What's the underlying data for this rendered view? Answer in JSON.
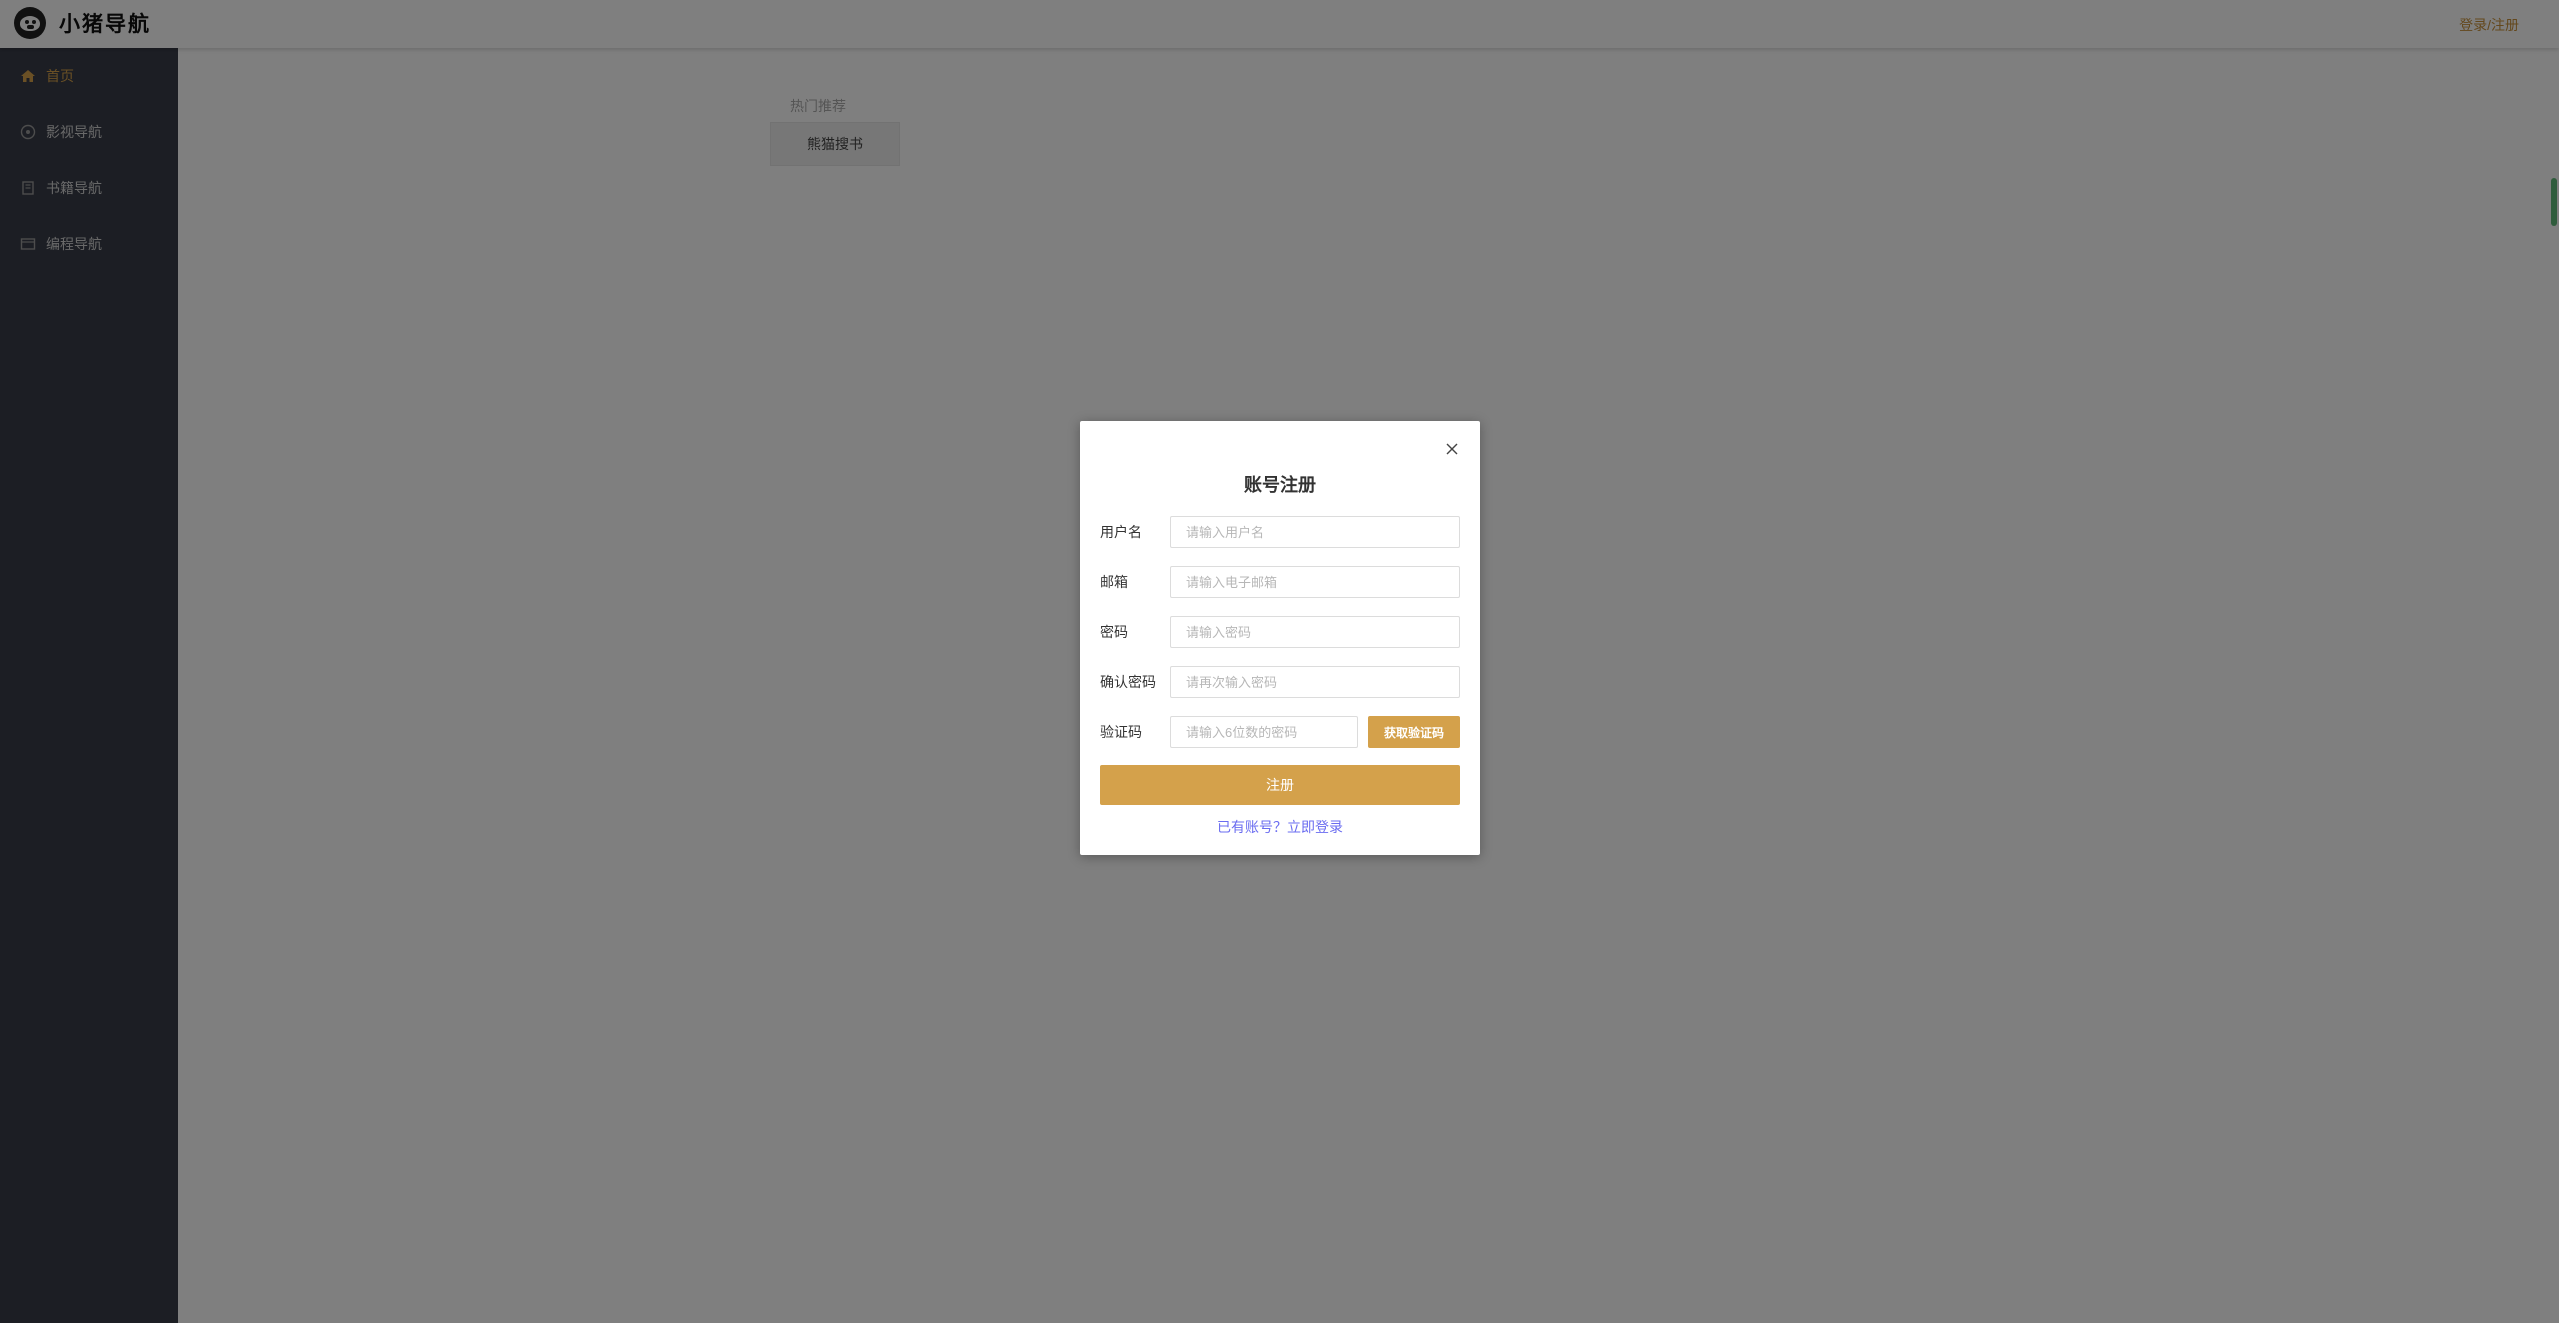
{
  "header": {
    "logo_text": "小猪导航",
    "login_link": "登录/注册"
  },
  "sidebar": {
    "items": [
      {
        "label": "首页",
        "icon": "home-icon",
        "active": true
      },
      {
        "label": "影视导航",
        "icon": "film-icon",
        "active": false
      },
      {
        "label": "书籍导航",
        "icon": "book-icon",
        "active": false
      },
      {
        "label": "编程导航",
        "icon": "code-icon",
        "active": false
      }
    ]
  },
  "main": {
    "hot_title": "热门推荐",
    "hot_items": [
      {
        "label": "熊猫搜书"
      }
    ]
  },
  "modal": {
    "title": "账号注册",
    "fields": [
      {
        "label": "用户名",
        "placeholder": "请输入用户名",
        "value": ""
      },
      {
        "label": "邮箱",
        "placeholder": "请输入电子邮箱",
        "value": ""
      },
      {
        "label": "密码",
        "placeholder": "请输入密码",
        "value": ""
      },
      {
        "label": "确认密码",
        "placeholder": "请再次输入密码",
        "value": ""
      },
      {
        "label": "验证码",
        "placeholder": "请输入6位数的密码",
        "value": ""
      }
    ],
    "get_code_label": "获取验证码",
    "submit_label": "注册",
    "login_prompt": "已有账号？立即登录"
  },
  "colors": {
    "accent": "#d4a14b",
    "sidebar_bg": "#393d49",
    "link": "#6a6cf0",
    "overlay": "rgba(0,0,0,0.5)"
  }
}
